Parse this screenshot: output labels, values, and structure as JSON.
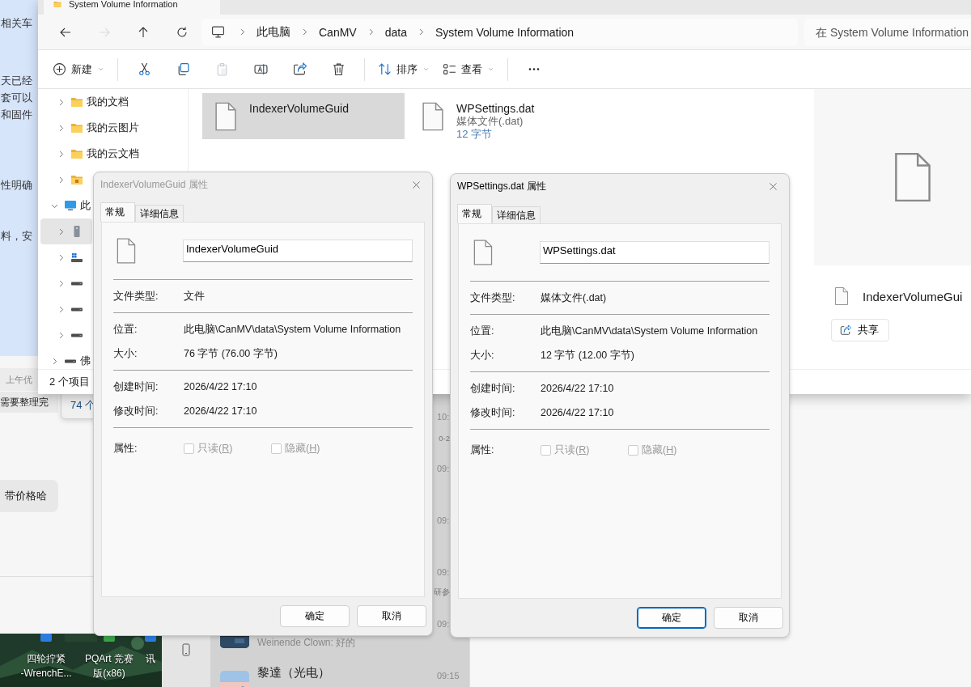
{
  "chat_app": {
    "snippets": [
      "相关车",
      "天已经",
      "套可以",
      "和固件",
      "性明确",
      "料，安"
    ],
    "notice": "上午优",
    "message": "需要整理完",
    "bubble": "带价格哈",
    "behind_window": {
      "status": "74 个"
    },
    "chat_list": [
      {
        "time": "10:",
        "preview_tail": "0-2"
      },
      {
        "time": "09:"
      },
      {
        "time": "09:"
      },
      {
        "time": "09:",
        "preview_tail": "研参"
      },
      {
        "time": "09:",
        "preview": "Weinende Clown: 好的",
        "has_avatar": true
      },
      {
        "time": "09:15",
        "name": "黎達（光电）",
        "has_avatar": true
      }
    ]
  },
  "desktop_icons": [
    {
      "label_lines": [
        "四轮拧紧",
        "-WrenchE..."
      ],
      "color": "#2b7de0"
    },
    {
      "label_lines": [
        "PQArt 竞赛",
        "版(x86)"
      ],
      "color": "#3aa54a"
    },
    {
      "label_lines": [
        "讯"
      ],
      "color": "#2b7de0"
    }
  ],
  "explorer": {
    "tab_title": "System Volume Information",
    "nav_buttons": [
      {
        "kind": "back",
        "disabled": false
      },
      {
        "kind": "forward",
        "disabled": true
      },
      {
        "kind": "up",
        "disabled": false
      },
      {
        "kind": "refresh",
        "disabled": false
      }
    ],
    "breadcrumb": [
      "此电脑",
      "CanMV",
      "data",
      "System Volume Information"
    ],
    "search": {
      "placeholder": "在 System Volume Information"
    },
    "toolbar": [
      {
        "kind": "new",
        "label": "新建",
        "disabled": false
      },
      {
        "kind": "separator"
      },
      {
        "kind": "cut",
        "disabled": false
      },
      {
        "kind": "copy",
        "disabled": false
      },
      {
        "kind": "paste",
        "disabled": true
      },
      {
        "kind": "rename",
        "disabled": false
      },
      {
        "kind": "share",
        "disabled": false
      },
      {
        "kind": "delete",
        "disabled": false
      },
      {
        "kind": "separator"
      },
      {
        "kind": "sort",
        "label": "排序",
        "disabled": false
      },
      {
        "kind": "view",
        "label": "查看",
        "disabled": false
      },
      {
        "kind": "separator"
      },
      {
        "kind": "more",
        "disabled": false
      }
    ],
    "nav_tree": {
      "items": [
        {
          "children": [
            {
              "label": "我的文档",
              "kind": "folder",
              "expanded": false,
              "selected": false
            },
            {
              "label": "我的云图片",
              "kind": "folder",
              "expanded": false,
              "selected": false
            },
            {
              "label": "我的云文档",
              "kind": "folder",
              "expanded": false,
              "selected": false
            },
            {
              "kind": "folder-special",
              "expanded": false,
              "selected": false
            }
          ]
        },
        {
          "label": "此",
          "kind": "pc",
          "expanded": true,
          "selected": false,
          "children": [
            {
              "kind": "server-drive",
              "expanded": false,
              "selected": true
            },
            {
              "kind": "win-drive",
              "expanded": false,
              "selected": false
            },
            {
              "kind": "drive",
              "expanded": false,
              "selected": false
            },
            {
              "kind": "drive",
              "expanded": false,
              "selected": false
            },
            {
              "kind": "drive",
              "expanded": false,
              "selected": false
            }
          ]
        },
        {
          "label": "佛",
          "kind": "drive",
          "expanded": false,
          "selected": false
        }
      ]
    },
    "files": [
      {
        "name": "IndexerVolumeGuid",
        "selected": true
      },
      {
        "name": "WPSettings.dat",
        "type": "媒体文件(.dat)",
        "size": "12 字节",
        "selected": false
      }
    ],
    "preview": {
      "name": "IndexerVolumeGui",
      "share": "共享"
    },
    "status": "2 个项目"
  },
  "dialogs": [
    {
      "title": "IndexerVolumeGuid 属性",
      "active": false,
      "tabs": [
        {
          "label": "常规",
          "selected": true
        },
        {
          "label": "详细信息",
          "selected": false
        }
      ],
      "name": "IndexerVolumeGuid",
      "groups": [
        [
          {
            "label": "文件类型:",
            "value": "文件"
          }
        ],
        [
          {
            "label": "位置:",
            "value": "此电脑\\CanMV\\data\\System Volume Information"
          },
          {
            "label": "大小:",
            "value": "76 字节 (76.00 字节)"
          }
        ],
        [
          {
            "label": "创建时间:",
            "value": "2026/4/22 17:10"
          },
          {
            "label": "修改时间:",
            "value": "2026/4/22 17:10"
          }
        ]
      ],
      "attributes": {
        "label": "属性:",
        "options": [
          {
            "prefix": "只读(",
            "accesskey": "R",
            "suffix": ")",
            "checked": false,
            "disabled": true
          },
          {
            "prefix": "隐藏(",
            "accesskey": "H",
            "suffix": ")",
            "checked": false,
            "disabled": true
          }
        ]
      },
      "buttons": [
        {
          "label": "确定",
          "default": false
        },
        {
          "label": "取消",
          "default": false
        }
      ]
    },
    {
      "title": "WPSettings.dat 属性",
      "active": true,
      "tabs": [
        {
          "label": "常规",
          "selected": true
        },
        {
          "label": "详细信息",
          "selected": false
        }
      ],
      "name": "WPSettings.dat",
      "groups": [
        [
          {
            "label": "文件类型:",
            "value": "媒体文件(.dat)"
          }
        ],
        [
          {
            "label": "位置:",
            "value": "此电脑\\CanMV\\data\\System Volume Information"
          },
          {
            "label": "大小:",
            "value": "12 字节 (12.00 字节)"
          }
        ],
        [
          {
            "label": "创建时间:",
            "value": "2026/4/22 17:10"
          },
          {
            "label": "修改时间:",
            "value": "2026/4/22 17:10"
          }
        ]
      ],
      "attributes": {
        "label": "属性:",
        "options": [
          {
            "prefix": "只读(",
            "accesskey": "R",
            "suffix": ")",
            "checked": false,
            "disabled": true
          },
          {
            "prefix": "隐藏(",
            "accesskey": "H",
            "suffix": ")",
            "checked": false,
            "disabled": true
          }
        ]
      },
      "buttons": [
        {
          "label": "确定",
          "default": true
        },
        {
          "label": "取消",
          "default": false
        }
      ]
    }
  ]
}
